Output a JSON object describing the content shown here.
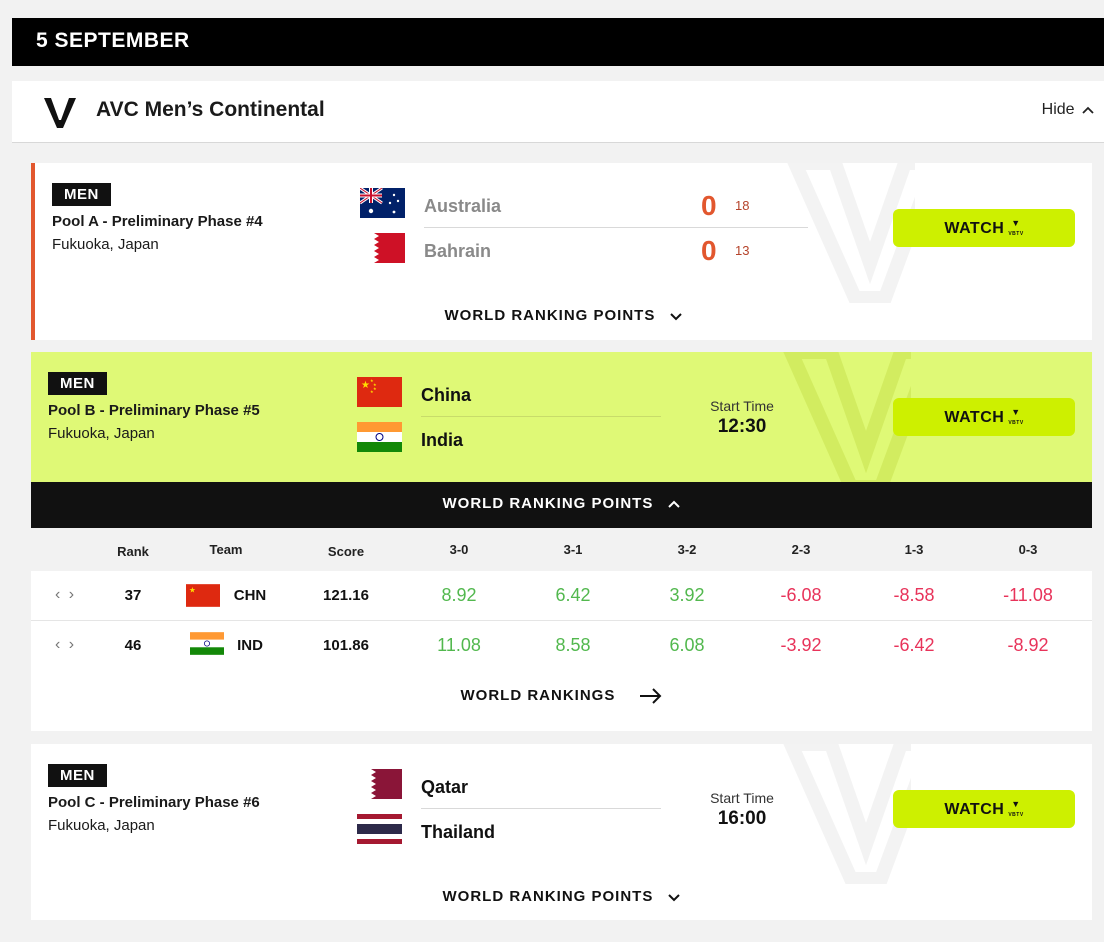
{
  "date_header": "5 SEPTEMBER",
  "competition": {
    "title": "AVC Men’s Continental",
    "hide_label": "Hide"
  },
  "watch_label": "WATCH",
  "watch_brand": "VBTV",
  "wrp_label": "WORLD RANKING POINTS",
  "matches": [
    {
      "badge": "MEN",
      "pool": "Pool A - Preliminary Phase #4",
      "location": "Fukuoka, Japan",
      "home": {
        "name": "Australia",
        "sets": "0",
        "points": "18"
      },
      "away": {
        "name": "Bahrain",
        "sets": "0",
        "points": "13"
      }
    },
    {
      "badge": "MEN",
      "pool": "Pool B - Preliminary Phase #5",
      "location": "Fukuoka, Japan",
      "home": {
        "name": "China"
      },
      "away": {
        "name": "India"
      },
      "start_label": "Start Time",
      "start_time": "12:30"
    },
    {
      "badge": "MEN",
      "pool": "Pool C - Preliminary Phase #6",
      "location": "Fukuoka, Japan",
      "home": {
        "name": "Qatar"
      },
      "away": {
        "name": "Thailand"
      },
      "start_label": "Start Time",
      "start_time": "16:00"
    }
  ],
  "rankings_table": {
    "headers": [
      "Rank",
      "Team",
      "Score",
      "3-0",
      "3-1",
      "3-2",
      "2-3",
      "1-3",
      "0-3"
    ],
    "rows": [
      {
        "rank": "37",
        "code": "CHN",
        "score": "121.16",
        "values": [
          "8.92",
          "6.42",
          "3.92",
          "-6.08",
          "-8.58",
          "-11.08"
        ]
      },
      {
        "rank": "46",
        "code": "IND",
        "score": "101.86",
        "values": [
          "11.08",
          "8.58",
          "6.08",
          "-3.92",
          "-6.42",
          "-8.92"
        ]
      }
    ],
    "world_rankings_link": "WORLD RANKINGS"
  },
  "colors": {
    "accent_live": "#e2572e",
    "highlight": "#dff976",
    "watch_button": "#cdf000",
    "positive": "#52b84e",
    "negative": "#e8335a"
  }
}
